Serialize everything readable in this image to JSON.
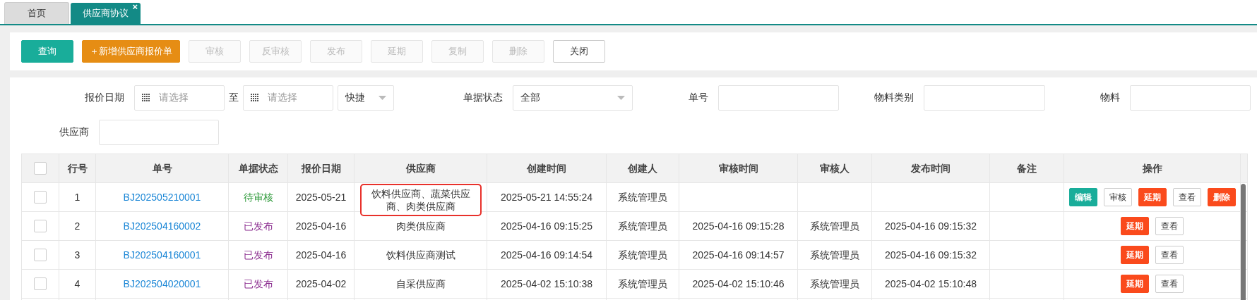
{
  "tabs": [
    {
      "label": "首页",
      "selected": false
    },
    {
      "label": "供应商协议",
      "selected": true,
      "close": "×"
    }
  ],
  "toolbar": [
    {
      "label": "查询",
      "kind": "primary",
      "disabled": false
    },
    {
      "label": "新增供应商报价单",
      "icon": "＋",
      "kind": "warning",
      "disabled": false
    },
    {
      "label": "审核",
      "kind": "default",
      "disabled": true
    },
    {
      "label": "反审核",
      "kind": "default",
      "disabled": true
    },
    {
      "label": "发布",
      "kind": "default",
      "disabled": true
    },
    {
      "label": "延期",
      "kind": "default",
      "disabled": true
    },
    {
      "label": "复制",
      "kind": "default",
      "disabled": true
    },
    {
      "label": "删除",
      "kind": "default",
      "disabled": true
    },
    {
      "label": "关闭",
      "kind": "default",
      "disabled": false
    }
  ],
  "filters": {
    "quote_date": {
      "label": "报价日期",
      "from_placeholder": "请选择",
      "separator": "至",
      "to_placeholder": "请选择",
      "shortcut": "快捷"
    },
    "status": {
      "label": "单据状态",
      "value": "全部"
    },
    "number": {
      "label": "单号"
    },
    "material_category": {
      "label": "物料类别"
    },
    "material": {
      "label": "物料"
    },
    "supplier": {
      "label": "供应商"
    }
  },
  "table": {
    "select_all": false,
    "columns": [
      "行号",
      "单号",
      "单据状态",
      "报价日期",
      "供应商",
      "创建时间",
      "创建人",
      "审核时间",
      "审核人",
      "发布时间",
      "备注",
      "操作"
    ],
    "rows": [
      {
        "checked": false,
        "no": "1",
        "number": "BJ202505210001",
        "status": "待审核",
        "color": "#2e9a3a",
        "date": "2025-05-21",
        "supplier": "饮料供应商、蔬菜供应商、肉类供应商",
        "highlighted": true,
        "created": "2025-05-21 14:55:24",
        "creator": "系统管理员",
        "audited": "",
        "auditor": "",
        "published": "",
        "actions": [
          {
            "label": "编辑",
            "kind": "edit"
          },
          {
            "label": "审核",
            "kind": "outline"
          },
          {
            "label": "延期",
            "kind": "danger"
          },
          {
            "label": "查看",
            "kind": "outline"
          },
          {
            "label": "删除",
            "kind": "danger"
          }
        ]
      },
      {
        "checked": false,
        "no": "2",
        "number": "BJ202504160002",
        "status": "已发布",
        "color": "#8a2b8e",
        "date": "2025-04-16",
        "supplier": "肉类供应商",
        "highlighted": false,
        "created": "2025-04-16 09:15:25",
        "creator": "系统管理员",
        "audited": "2025-04-16 09:15:28",
        "auditor": "系统管理员",
        "published": "2025-04-16 09:15:32",
        "actions": [
          {
            "label": "延期",
            "kind": "danger"
          },
          {
            "label": "查看",
            "kind": "outline"
          }
        ]
      },
      {
        "checked": false,
        "no": "3",
        "number": "BJ202504160001",
        "status": "已发布",
        "color": "#8a2b8e",
        "date": "2025-04-16",
        "supplier": "饮料供应商测试",
        "highlighted": false,
        "created": "2025-04-16 09:14:54",
        "creator": "系统管理员",
        "audited": "2025-04-16 09:14:57",
        "auditor": "系统管理员",
        "published": "2025-04-16 09:15:32",
        "actions": [
          {
            "label": "延期",
            "kind": "danger"
          },
          {
            "label": "查看",
            "kind": "outline"
          }
        ]
      },
      {
        "checked": false,
        "no": "4",
        "number": "BJ202504020001",
        "status": "已发布",
        "color": "#8a2b8e",
        "date": "2025-04-02",
        "supplier": "自采供应商",
        "highlighted": false,
        "created": "2025-04-02 15:10:38",
        "creator": "系统管理员",
        "audited": "2025-04-02 15:10:46",
        "auditor": "系统管理员",
        "published": "2025-04-02 15:10:48",
        "actions": [
          {
            "label": "延期",
            "kind": "danger"
          },
          {
            "label": "查看",
            "kind": "outline"
          }
        ]
      }
    ]
  }
}
